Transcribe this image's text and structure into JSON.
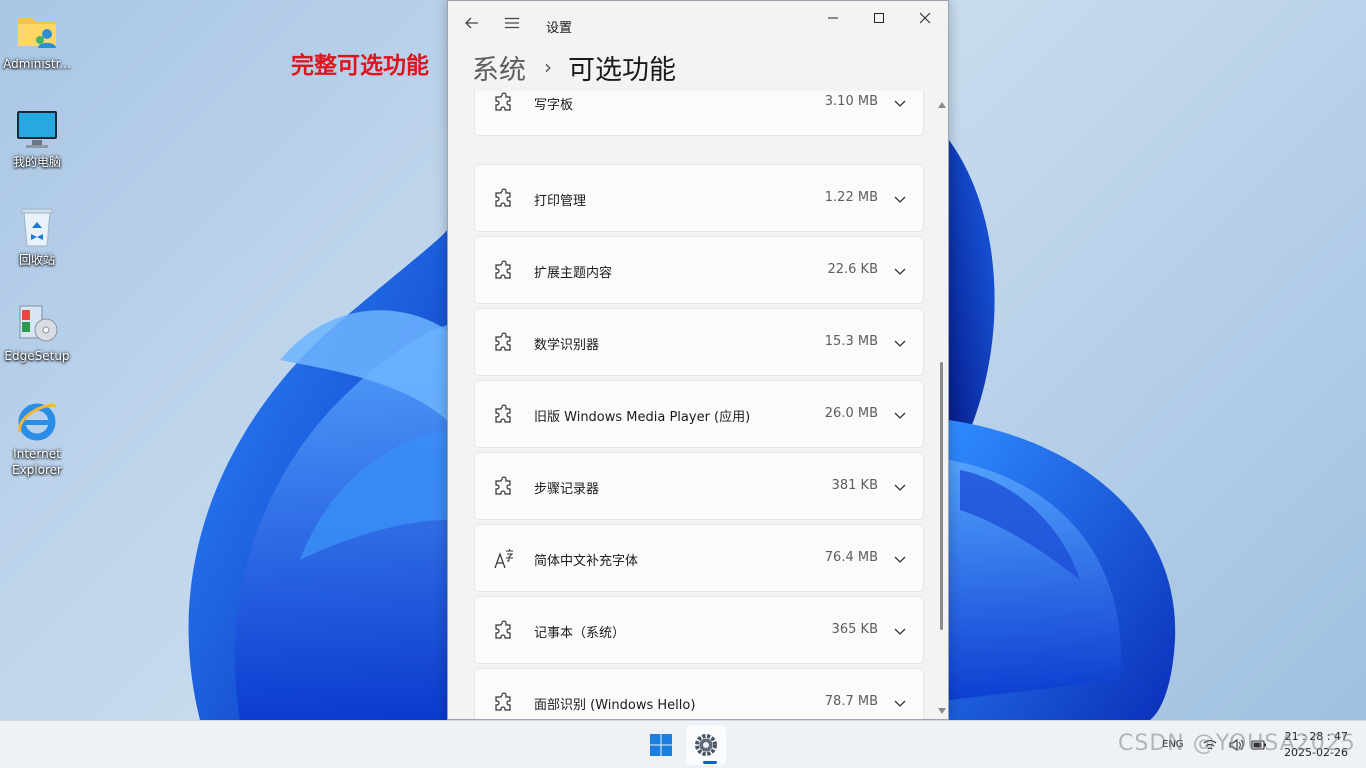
{
  "desktop": {
    "icons": [
      {
        "label": "Administr...",
        "icon": "user-folder-icon"
      },
      {
        "label": "我的电脑",
        "icon": "computer-icon"
      },
      {
        "label": "回收站",
        "icon": "recycle-bin-icon"
      },
      {
        "label": "EdgeSetup",
        "icon": "installer-icon"
      },
      {
        "label": "Internet Explorer",
        "icon": "internet-explorer-icon"
      }
    ],
    "annotation": "完整可选功能"
  },
  "window": {
    "title": "设置",
    "breadcrumb": {
      "parent": "系统",
      "separator": "›",
      "current": "可选功能"
    },
    "features": [
      {
        "name": "写字板",
        "size": "3.10 MB",
        "icon": "puzzle-icon"
      },
      {
        "name": "打印管理",
        "size": "1.22 MB",
        "icon": "puzzle-icon"
      },
      {
        "name": "扩展主题内容",
        "size": "22.6 KB",
        "icon": "puzzle-icon"
      },
      {
        "name": "数学识别器",
        "size": "15.3 MB",
        "icon": "puzzle-icon"
      },
      {
        "name": "旧版 Windows Media Player (应用)",
        "size": "26.0 MB",
        "icon": "puzzle-icon"
      },
      {
        "name": "步骤记录器",
        "size": "381 KB",
        "icon": "puzzle-icon"
      },
      {
        "name": "简体中文补充字体",
        "size": "76.4 MB",
        "icon": "font-icon"
      },
      {
        "name": "记事本（系统）",
        "size": "365 KB",
        "icon": "puzzle-icon"
      },
      {
        "name": "面部识别 (Windows Hello)",
        "size": "78.7 MB",
        "icon": "puzzle-icon"
      }
    ]
  },
  "taskbar": {
    "language": "ENG",
    "time": "21 : 28 : 47",
    "date": "2025-02-26"
  },
  "watermark": "CSDN @YOUSA2025",
  "colors": {
    "accent": "#0a64c8",
    "annotation": "#e0141e",
    "window_bg": "#f3f3f3",
    "card_bg": "#fbfbfb"
  }
}
